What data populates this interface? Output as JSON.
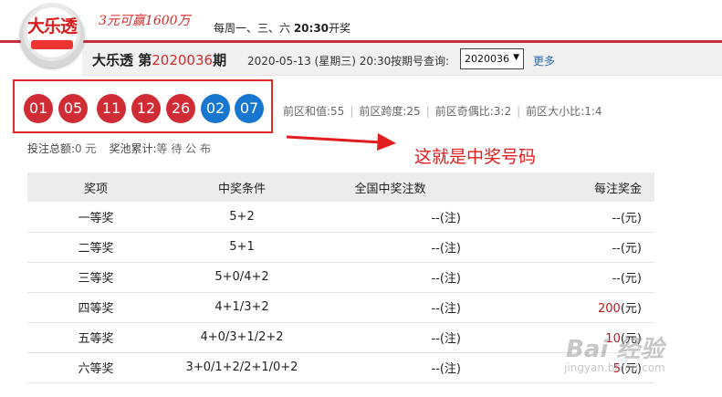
{
  "header": {
    "slogan": "3元可赢1600万",
    "draw_days_prefix": "每周一、三、六 ",
    "draw_time": "20:30",
    "draw_days_suffix": "开奖"
  },
  "info": {
    "game_name": "大乐透",
    "period_prefix": " 第",
    "period": "2020036",
    "period_suffix": "期",
    "draw_date": "2020-05-13 (星期三) 20:30",
    "query_label": "按期号查询:",
    "selected_period": "2020036",
    "more": "更多"
  },
  "balls": {
    "front": [
      "01",
      "05",
      "11",
      "12",
      "26"
    ],
    "back": [
      "02",
      "07"
    ]
  },
  "stats": [
    {
      "label": "前区和值:",
      "value": "55"
    },
    {
      "label": "前区跨度:",
      "value": "25"
    },
    {
      "label": "前区奇偶比:",
      "value": "3:2"
    },
    {
      "label": "前区大小比:",
      "value": "1:4"
    }
  ],
  "totals": {
    "sales_label": "投注总额:",
    "sales_value": "0 元",
    "pool_label": "奖池累计:",
    "pool_value": "等 待 公 布"
  },
  "annotation": "这就是中奖号码",
  "table": {
    "headers": [
      "奖项",
      "中奖条件",
      "全国中奖注数",
      "每注奖金"
    ],
    "rows": [
      {
        "level": "一等奖",
        "condition": "5+2",
        "count": "--(注)",
        "amount": "--",
        "unit": "(元)"
      },
      {
        "level": "二等奖",
        "condition": "5+1",
        "count": "--(注)",
        "amount": "--",
        "unit": "(元)"
      },
      {
        "level": "三等奖",
        "condition": "5+0/4+2",
        "count": "--(注)",
        "amount": "--",
        "unit": "(元)"
      },
      {
        "level": "四等奖",
        "condition": "4+1/3+2",
        "count": "--(注)",
        "amount": "200",
        "unit": "(元)"
      },
      {
        "level": "五等奖",
        "condition": "4+0/3+1/2+2",
        "count": "--(注)",
        "amount": "10",
        "unit": "(元)"
      },
      {
        "level": "六等奖",
        "condition": "3+0/1+2/2+1/0+2",
        "count": "--(注)",
        "amount": "5",
        "unit": "(元)"
      }
    ]
  },
  "watermark": {
    "brand": "Bai 经验",
    "url": "jingyan.baidu.com"
  },
  "colors": {
    "front_ball": "#d02c35",
    "back_ball": "#1777d0",
    "accent_red": "#e11d1d"
  }
}
